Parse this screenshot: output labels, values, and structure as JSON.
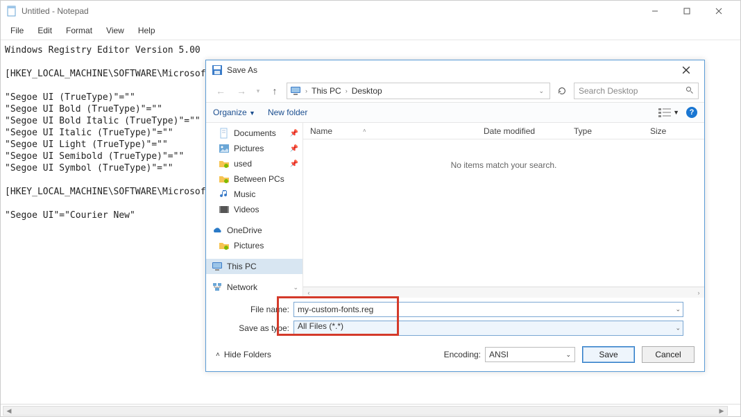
{
  "notepad": {
    "title": "Untitled - Notepad",
    "menu": {
      "file": "File",
      "edit": "Edit",
      "format": "Format",
      "view": "View",
      "help": "Help"
    },
    "content": "Windows Registry Editor Version 5.00\n\n[HKEY_LOCAL_MACHINE\\SOFTWARE\\Microsof\n\n\"Segoe UI (TrueType)\"=\"\"\n\"Segoe UI Bold (TrueType)\"=\"\"\n\"Segoe UI Bold Italic (TrueType)\"=\"\"\n\"Segoe UI Italic (TrueType)\"=\"\"\n\"Segoe UI Light (TrueType)\"=\"\"\n\"Segoe UI Semibold (TrueType)\"=\"\"\n\"Segoe UI Symbol (TrueType)\"=\"\"\n\n[HKEY_LOCAL_MACHINE\\SOFTWARE\\Microsof\n\n\"Segoe UI\"=\"Courier New\""
  },
  "dialog": {
    "title": "Save As",
    "breadcrumb": {
      "root": "This PC",
      "current": "Desktop"
    },
    "search_placeholder": "Search Desktop",
    "toolbar": {
      "organize": "Organize",
      "newfolder": "New folder"
    },
    "nav": {
      "documents": "Documents",
      "pictures": "Pictures",
      "used": "used",
      "betweenpcs": "Between PCs",
      "music": "Music",
      "videos": "Videos",
      "onedrive": "OneDrive",
      "od_pictures": "Pictures",
      "thispc": "This PC",
      "network": "Network"
    },
    "columns": {
      "name": "Name",
      "date": "Date modified",
      "type": "Type",
      "size": "Size"
    },
    "empty": "No items match your search.",
    "fields": {
      "filename_label": "File name:",
      "filename_value": "my-custom-fonts.reg",
      "savetype_label": "Save as type:",
      "savetype_value": "All Files  (*.*)"
    },
    "bottom": {
      "hidefolders": "Hide Folders",
      "encoding_label": "Encoding:",
      "encoding_value": "ANSI",
      "save": "Save",
      "cancel": "Cancel"
    }
  }
}
